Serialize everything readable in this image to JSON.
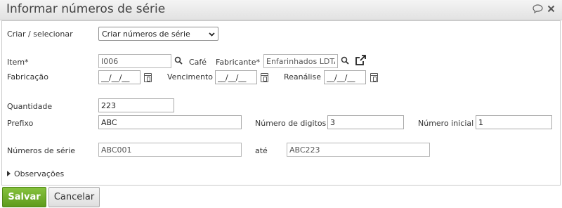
{
  "dialog": {
    "title": "Informar números de série",
    "icons": [
      "chat-icon",
      "close-icon"
    ]
  },
  "form": {
    "create_select": {
      "label": "Criar / selecionar",
      "value": "Criar números de série"
    },
    "item": {
      "label": "Item*",
      "value": "I006",
      "description": "Café"
    },
    "manufacturer": {
      "label": "Fabricante*",
      "value": "Enfarinhados LDTA"
    },
    "manufacture_date": {
      "label": "Fabricação",
      "placeholder": "__/__/__"
    },
    "expiry_date": {
      "label": "Vencimento",
      "placeholder": "__/__/__"
    },
    "reanalysis_date": {
      "label": "Reanálise",
      "placeholder": "__/__/__"
    },
    "quantity": {
      "label": "Quantidade",
      "value": "223"
    },
    "prefix": {
      "label": "Prefixo",
      "value": "ABC"
    },
    "digits": {
      "label": "Número de digitos",
      "value": "3"
    },
    "initial_number": {
      "label": "Número inicial",
      "value": "1"
    },
    "serials": {
      "label": "Números de série",
      "from": "ABC001",
      "to_label": "até",
      "to": "ABC223"
    },
    "notes": {
      "label": "Observações"
    }
  },
  "actions": {
    "save_label": "Salvar",
    "cancel_label": "Cancelar"
  }
}
